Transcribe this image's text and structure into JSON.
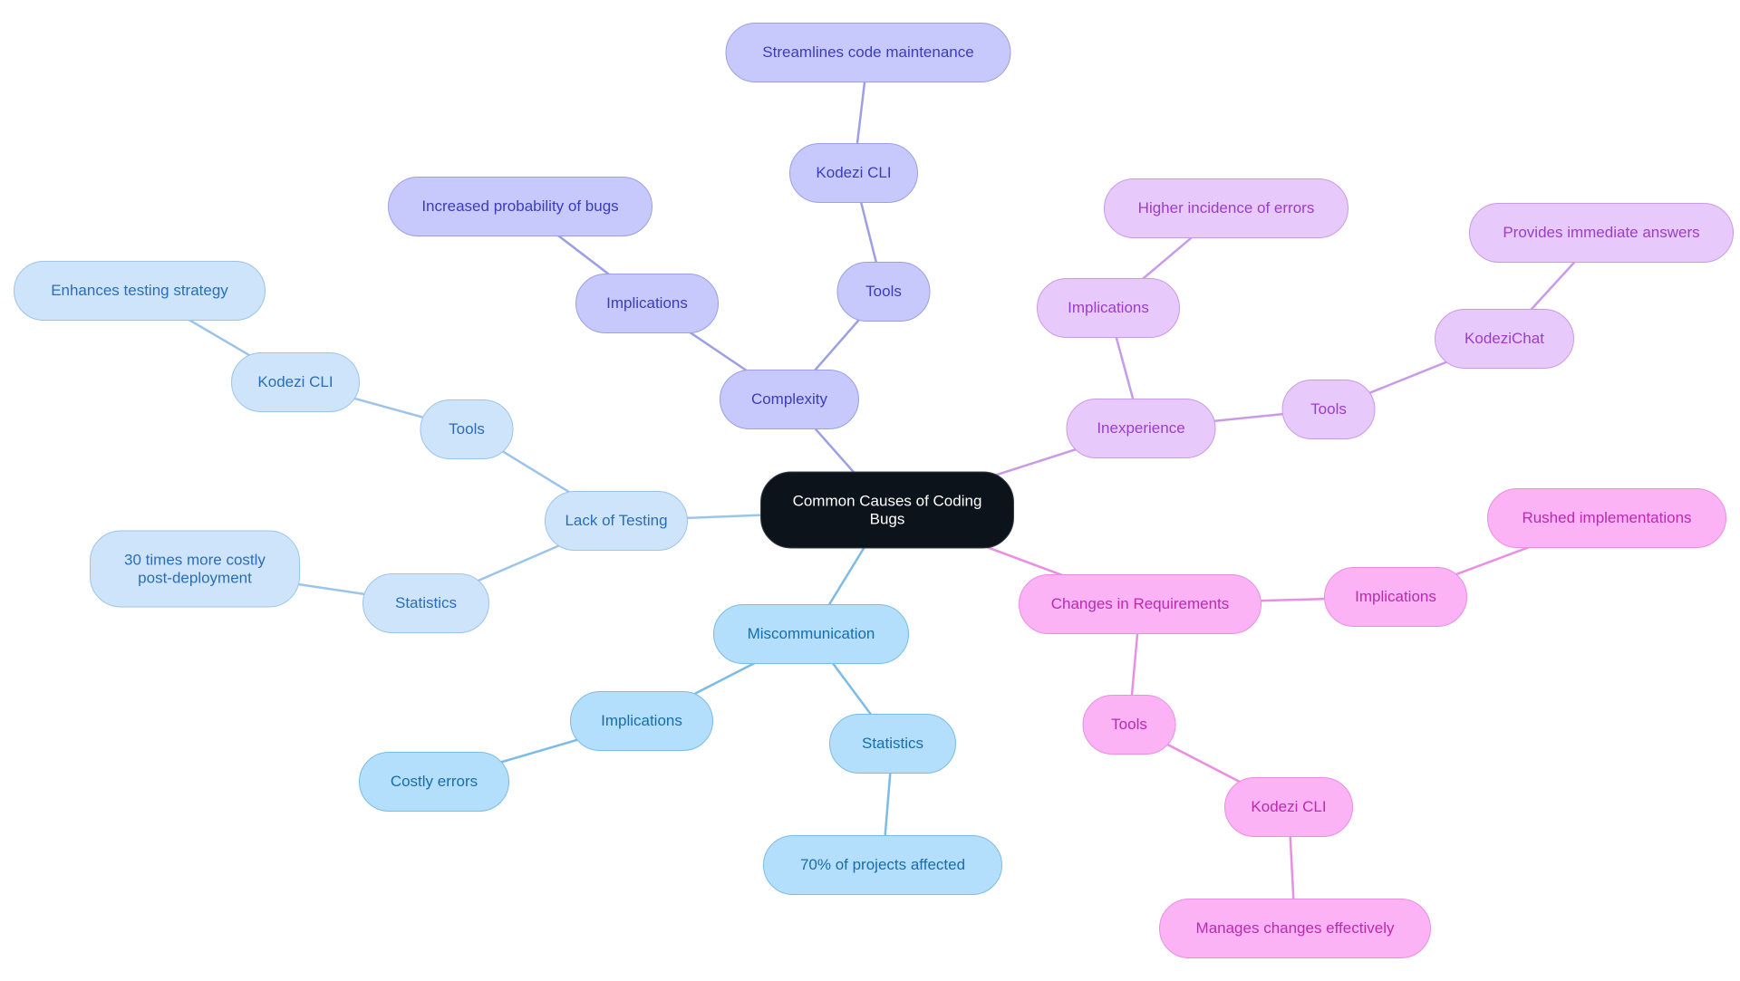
{
  "diagram": {
    "type": "mindmap",
    "root": {
      "id": "root",
      "label": "Common Causes of Coding Bugs"
    },
    "branch_colors": {
      "complexity": {
        "fill": "#c7c9fd",
        "stroke": "#9c9fe6",
        "text": "#3a3db8",
        "edge": "#9c9fe6"
      },
      "testing": {
        "fill": "#cde4fb",
        "stroke": "#9cc4ea",
        "text": "#2a6db8",
        "edge": "#9cc4ea"
      },
      "misc": {
        "fill": "#b3dffc",
        "stroke": "#7cbbe6",
        "text": "#1a6da8",
        "edge": "#7cbbe6"
      },
      "inex": {
        "fill": "#e7c9fc",
        "stroke": "#c99ae8",
        "text": "#9a3ec8",
        "edge": "#c99ae8"
      },
      "change": {
        "fill": "#fbb3f5",
        "stroke": "#ea8ee2",
        "text": "#b82cad",
        "edge": "#ea8ee2"
      }
    },
    "nodes": [
      {
        "id": "root",
        "label": "Common Causes of Coding Bugs",
        "parent": null,
        "branch": "root"
      },
      {
        "id": "complexity",
        "label": "Complexity",
        "parent": "root",
        "branch": "complexity"
      },
      {
        "id": "cx-impl",
        "label": "Implications",
        "parent": "complexity",
        "branch": "complexity"
      },
      {
        "id": "cx-impl-1",
        "label": "Increased probability of bugs",
        "parent": "cx-impl",
        "branch": "complexity"
      },
      {
        "id": "cx-tools",
        "label": "Tools",
        "parent": "complexity",
        "branch": "complexity"
      },
      {
        "id": "cx-cli",
        "label": "Kodezi CLI",
        "parent": "cx-tools",
        "branch": "complexity"
      },
      {
        "id": "cx-cli-1",
        "label": "Streamlines code maintenance",
        "parent": "cx-cli",
        "branch": "complexity"
      },
      {
        "id": "testing",
        "label": "Lack of Testing",
        "parent": "root",
        "branch": "testing"
      },
      {
        "id": "t-tools",
        "label": "Tools",
        "parent": "testing",
        "branch": "testing"
      },
      {
        "id": "t-cli",
        "label": "Kodezi CLI",
        "parent": "t-tools",
        "branch": "testing"
      },
      {
        "id": "t-cli-1",
        "label": "Enhances testing strategy",
        "parent": "t-cli",
        "branch": "testing"
      },
      {
        "id": "t-stats",
        "label": "Statistics",
        "parent": "testing",
        "branch": "testing"
      },
      {
        "id": "t-stats-1",
        "label": "30 times more costly post-deployment",
        "parent": "t-stats",
        "branch": "testing"
      },
      {
        "id": "misc",
        "label": "Miscommunication",
        "parent": "root",
        "branch": "misc"
      },
      {
        "id": "m-impl",
        "label": "Implications",
        "parent": "misc",
        "branch": "misc"
      },
      {
        "id": "m-impl-1",
        "label": "Costly errors",
        "parent": "m-impl",
        "branch": "misc"
      },
      {
        "id": "m-stats",
        "label": "Statistics",
        "parent": "misc",
        "branch": "misc"
      },
      {
        "id": "m-stats-1",
        "label": "70% of projects affected",
        "parent": "m-stats",
        "branch": "misc"
      },
      {
        "id": "inex",
        "label": "Inexperience",
        "parent": "root",
        "branch": "inex"
      },
      {
        "id": "i-impl",
        "label": "Implications",
        "parent": "inex",
        "branch": "inex"
      },
      {
        "id": "i-impl-1",
        "label": "Higher incidence of errors",
        "parent": "i-impl",
        "branch": "inex"
      },
      {
        "id": "i-tools",
        "label": "Tools",
        "parent": "inex",
        "branch": "inex"
      },
      {
        "id": "i-chat",
        "label": "KodeziChat",
        "parent": "i-tools",
        "branch": "inex"
      },
      {
        "id": "i-chat-1",
        "label": "Provides immediate answers",
        "parent": "i-chat",
        "branch": "inex"
      },
      {
        "id": "change",
        "label": "Changes in Requirements",
        "parent": "root",
        "branch": "change"
      },
      {
        "id": "c-impl",
        "label": "Implications",
        "parent": "change",
        "branch": "change"
      },
      {
        "id": "c-impl-1",
        "label": "Rushed implementations",
        "parent": "c-impl",
        "branch": "change"
      },
      {
        "id": "c-tools",
        "label": "Tools",
        "parent": "change",
        "branch": "change"
      },
      {
        "id": "c-cli",
        "label": "Kodezi CLI",
        "parent": "c-tools",
        "branch": "change"
      },
      {
        "id": "c-cli-1",
        "label": "Manages changes effectively",
        "parent": "c-cli",
        "branch": "change"
      }
    ]
  }
}
